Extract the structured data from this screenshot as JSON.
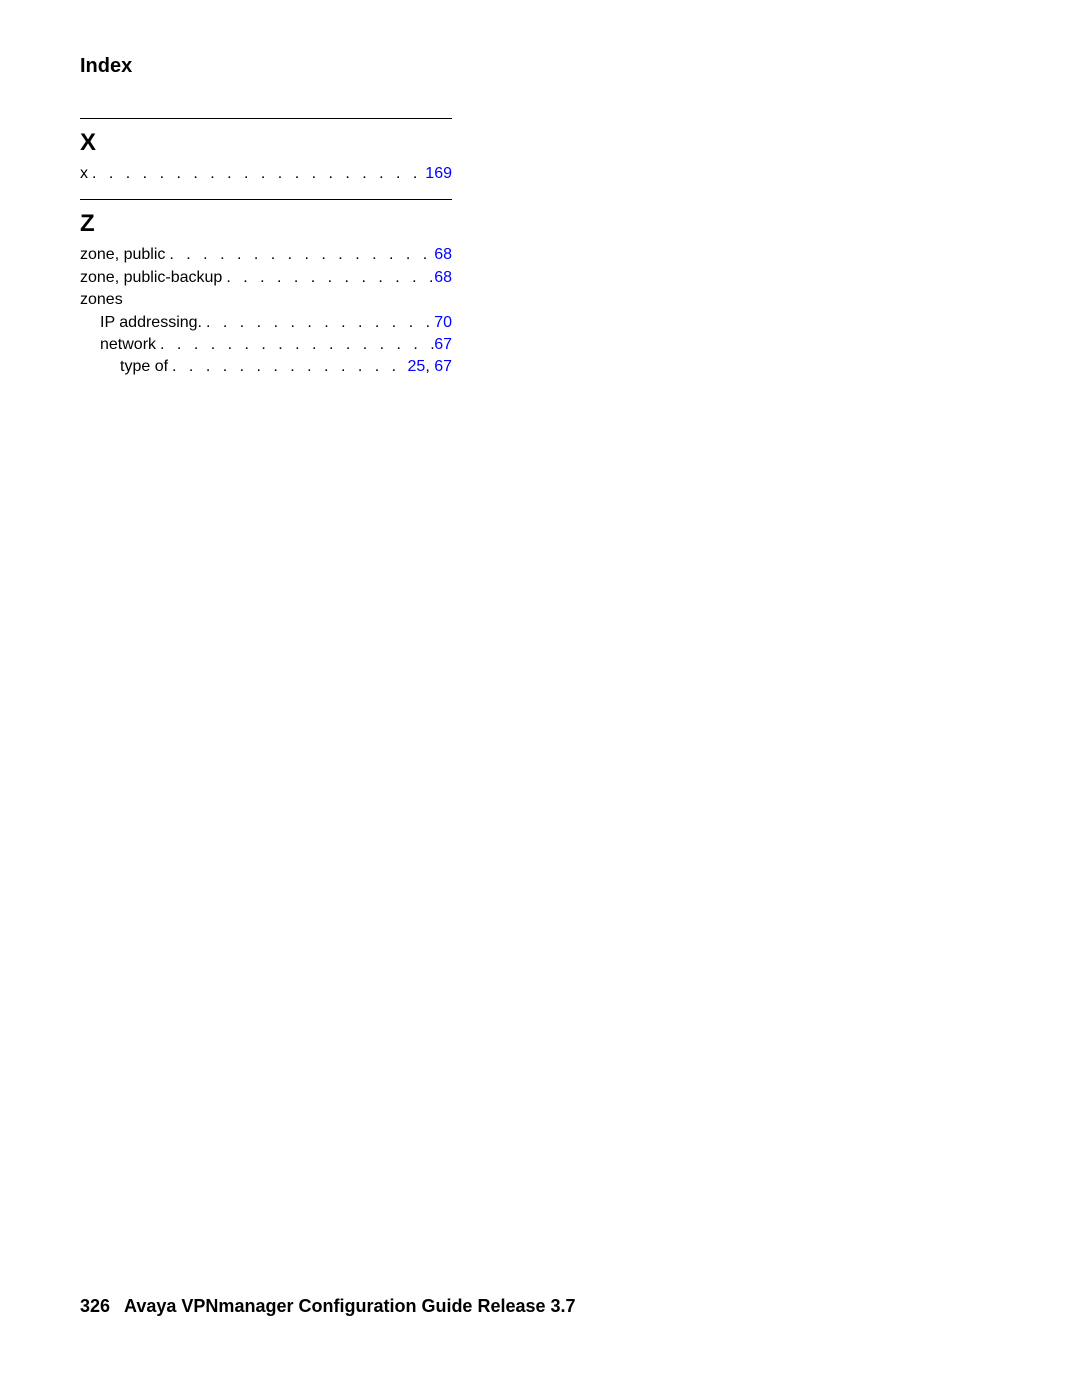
{
  "header": {
    "title": "Index"
  },
  "leaders": ".  .  .  .  .  .  .  .  .  .  .  .  .  .  .  .  .  .  .  .  .  .  .  .  .  .  .  .  .  .  .  .",
  "sections": [
    {
      "letter": "X",
      "entries": [
        {
          "term": "x",
          "indent": 0,
          "pages": [
            "169"
          ],
          "leaders": true
        }
      ]
    },
    {
      "letter": "Z",
      "entries": [
        {
          "term": "zone, public",
          "indent": 0,
          "pages": [
            "68"
          ],
          "leaders": true
        },
        {
          "term": "zone, public-backup",
          "indent": 0,
          "pages": [
            "68"
          ],
          "leaders": true
        },
        {
          "term": "zones",
          "indent": 0,
          "pages": [],
          "leaders": false
        },
        {
          "term": "IP addressing.",
          "indent": 1,
          "pages": [
            "70"
          ],
          "leaders": true
        },
        {
          "term": "network",
          "indent": 1,
          "pages": [
            "67"
          ],
          "leaders": true
        },
        {
          "term": "type of",
          "indent": 2,
          "pages": [
            "25",
            "67"
          ],
          "leaders": true
        }
      ]
    }
  ],
  "comma": ", ",
  "footer": {
    "page_number": "326",
    "title": "Avaya VPNmanager Configuration Guide Release 3.7"
  }
}
